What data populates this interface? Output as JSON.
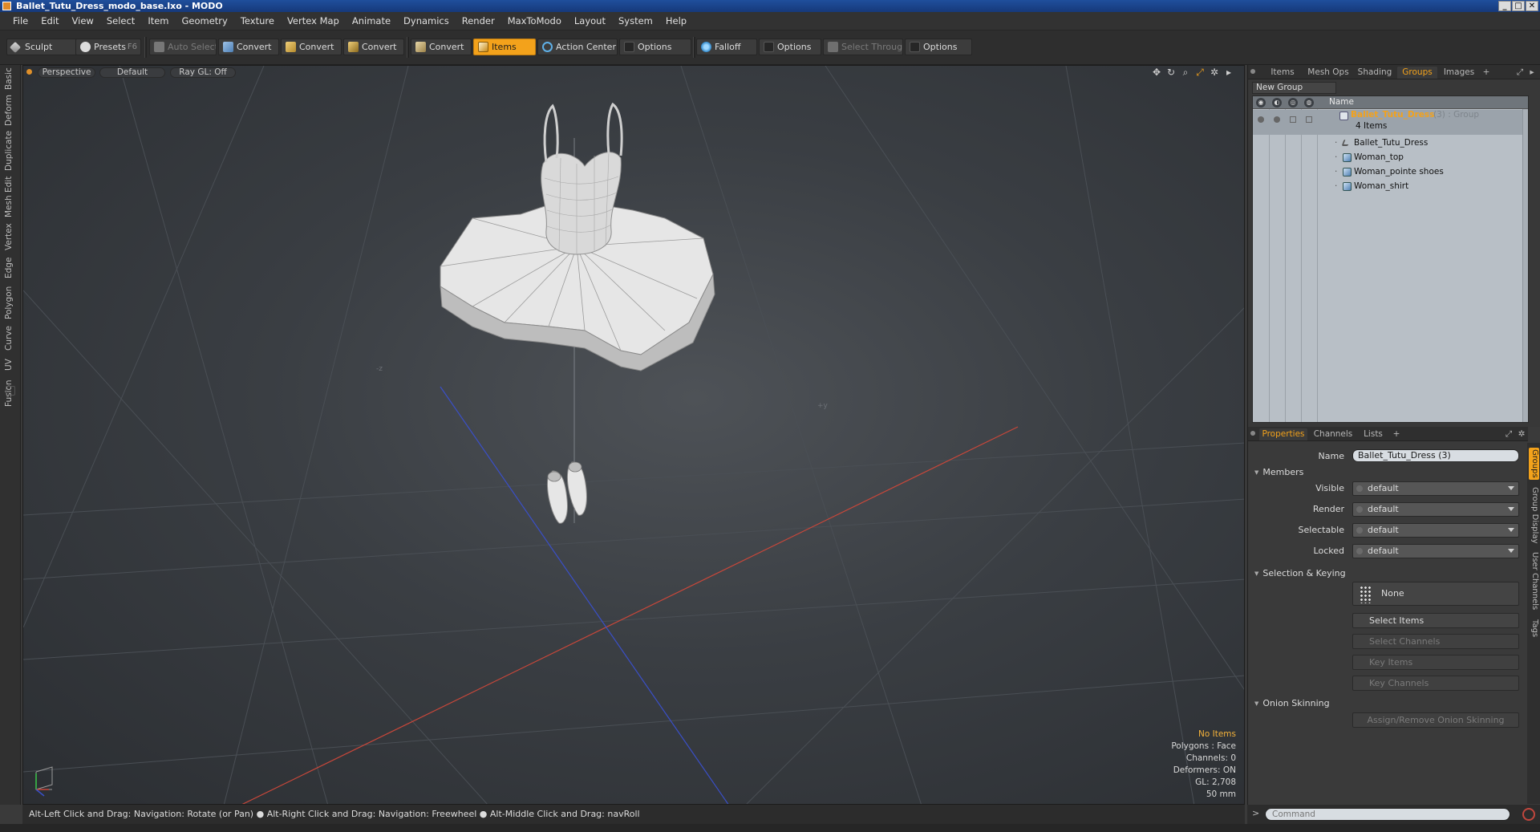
{
  "window": {
    "title": "Ballet_Tutu_Dress_modo_base.lxo - MODO",
    "buttons": [
      "_",
      "□",
      "✕"
    ]
  },
  "menu": [
    "File",
    "Edit",
    "View",
    "Select",
    "Item",
    "Geometry",
    "Texture",
    "Vertex Map",
    "Animate",
    "Dynamics",
    "Render",
    "MaxToModo",
    "Layout",
    "System",
    "Help"
  ],
  "toolbar": {
    "sculpt": "Sculpt",
    "presets": "Presets",
    "presets_key": "F6",
    "auto_select": "Auto Select",
    "convert": "Convert",
    "items": "Items",
    "action_center": "Action Center",
    "options": "Options",
    "falloff": "Falloff",
    "select_through": "Select Through"
  },
  "left_tabs": [
    "Basic",
    "Deform",
    "Duplicate",
    "Mesh Edit",
    "Vertex",
    "Edge",
    "Polygon",
    "Curve",
    "UV",
    "Fusion"
  ],
  "viewport": {
    "view": "Perspective",
    "shading": "Default",
    "raygl": "Ray GL: Off",
    "info": {
      "items": "No Items",
      "polygons": "Polygons : Face",
      "channels": "Channels: 0",
      "deformers": "Deformers: ON",
      "gl": "GL: 2,708",
      "units": "50 mm"
    }
  },
  "status_text": "Alt-Left Click and Drag: Navigation: Rotate (or Pan) ● Alt-Right Click and Drag: Navigation: Freewheel ● Alt-Middle Click and Drag: navRoll",
  "top_panel": {
    "tabs": [
      "Items",
      "Mesh Ops",
      "Shading",
      "Groups",
      "Images"
    ],
    "active_tab": "Groups",
    "new_group": "New Group",
    "column_name": "Name",
    "group": {
      "name": "Ballet_Tutu_Dress",
      "suffix": "(3) : Group",
      "count": "4 Items"
    },
    "children": [
      "Ballet_Tutu_Dress",
      "Woman_top",
      "Woman_pointe shoes",
      "Woman_shirt"
    ]
  },
  "bottom_panel": {
    "tabs": [
      "Properties",
      "Channels",
      "Lists"
    ],
    "active_tab": "Properties",
    "name_label": "Name",
    "name_value": "Ballet_Tutu_Dress (3)",
    "members_section": "Members",
    "fields": [
      {
        "label": "Visible",
        "value": "default"
      },
      {
        "label": "Render",
        "value": "default"
      },
      {
        "label": "Selectable",
        "value": "default"
      },
      {
        "label": "Locked",
        "value": "default"
      }
    ],
    "selection_section": "Selection & Keying",
    "none_label": "None",
    "select_items": "Select Items",
    "select_channels": "Select Channels",
    "key_items": "Key Items",
    "key_channels": "Key Channels",
    "onion_section": "Onion Skinning",
    "onion_button": "Assign/Remove Onion Skinning",
    "side_tabs": [
      "Groups",
      "Group Display",
      "User Channels",
      "Tags"
    ]
  },
  "command_placeholder": "Command",
  "colors": {
    "accent": "#f3a21b",
    "axis_x": "#c8473a",
    "axis_z": "#3a4fc8"
  }
}
